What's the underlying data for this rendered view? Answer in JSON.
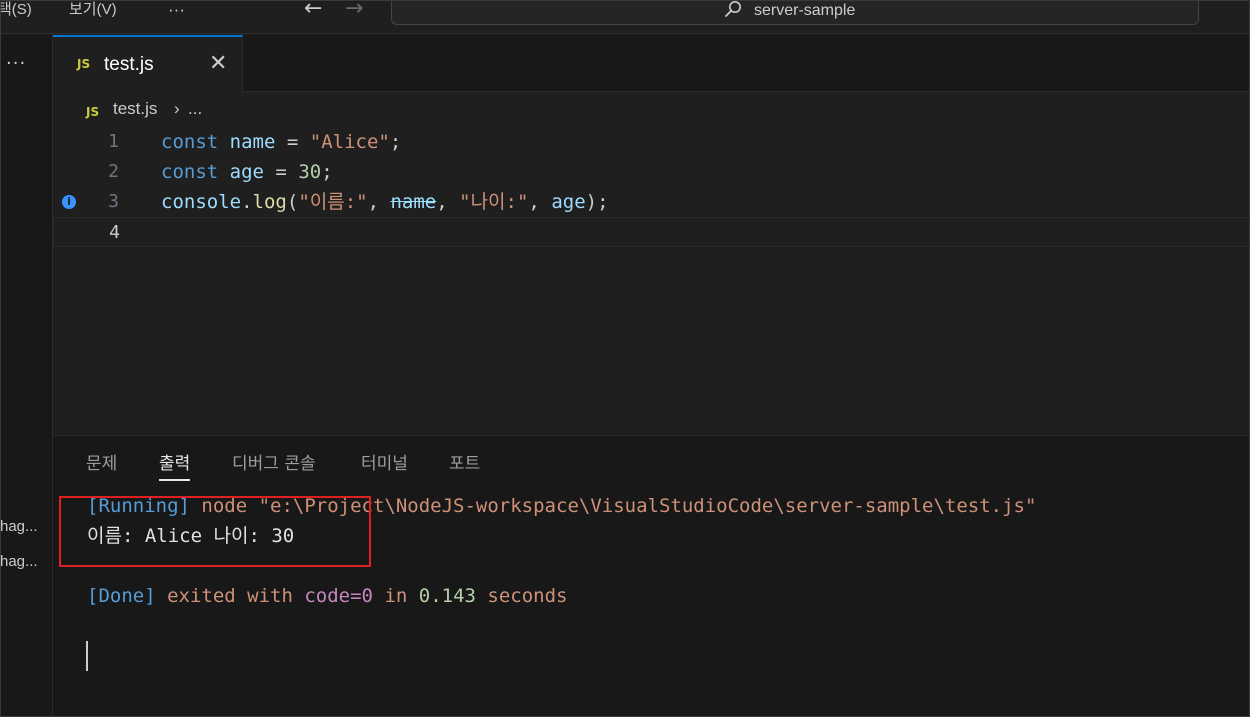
{
  "menu": {
    "selection": "택(S)",
    "view": "보기(V)",
    "more": "···"
  },
  "nav": {
    "back": "←",
    "forward": "→"
  },
  "search": {
    "text": "server-sample"
  },
  "sidebar": {
    "more": "···",
    "items": [
      "hag...",
      "hag..."
    ]
  },
  "tab": {
    "icon": "JS",
    "label": "test.js",
    "close": "✕"
  },
  "breadcrumb": {
    "icon": "JS",
    "file": "test.js",
    "separator": "›",
    "more": "..."
  },
  "editor": {
    "line_numbers": [
      "1",
      "2",
      "3",
      "4"
    ],
    "line1": {
      "kw": "const",
      "var": "name",
      "op": " = ",
      "str": "\"Alice\"",
      "end": ";"
    },
    "line2": {
      "kw": "const",
      "var": "age",
      "op": " = ",
      "num": "30",
      "end": ";"
    },
    "line3": {
      "obj": "console",
      "dot": ".",
      "fn": "log",
      "open": "(",
      "str1": "\"이름:\"",
      "comma1": ", ",
      "var1": "name",
      "comma2": ", ",
      "str2": "\"나이:\"",
      "comma3": ", ",
      "var2": "age",
      "close": ");"
    }
  },
  "panel": {
    "tabs": [
      "문제",
      "출력",
      "디버그 콘솔",
      "터미널",
      "포트"
    ],
    "active_tab": "출력",
    "output": {
      "running_tag": "[Running]",
      "running_cmd": " node \"e:\\Project\\NodeJS-workspace\\VisualStudioCode\\server-sample\\test.js\"",
      "result_label1": "이름: ",
      "result_name": "Alice",
      "result_label2": " 나이: ",
      "result_age": "30",
      "done_tag": "[Done]",
      "done_text1": " exited with ",
      "done_code": "code=0",
      "done_text2": " in ",
      "done_time": "0.143",
      "done_text3": " seconds"
    }
  },
  "colors": {
    "accent": "#0078d4",
    "highlight_box": "#e02020",
    "keyword": "#569cd6",
    "string": "#ce9178"
  }
}
